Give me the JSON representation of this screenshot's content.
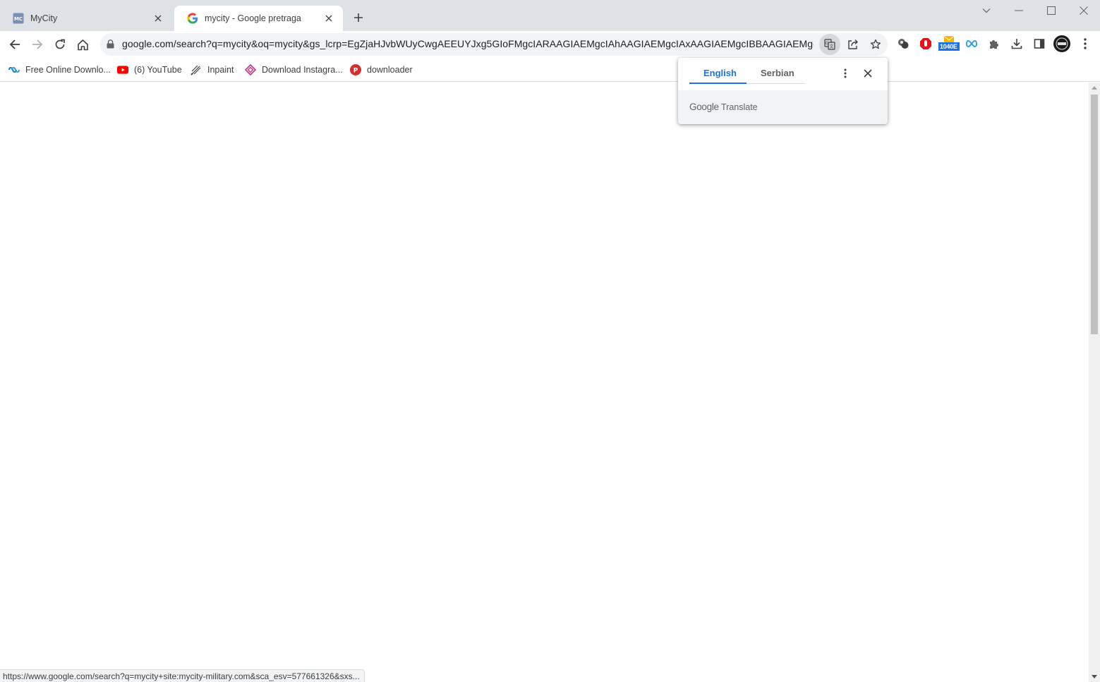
{
  "tabs": [
    {
      "title": "MyCity",
      "favicon": "mycity-favicon",
      "active": false
    },
    {
      "title": "mycity - Google pretraga",
      "favicon": "google-g-icon",
      "active": true
    }
  ],
  "toolbar": {
    "url": "google.com/search?q=mycity&oq=mycity&gs_lcrp=EgZjaHJvbWUyCwgAEEUYJxg5GIoFMgcIARAAGIAEMgcIAhAAGIAEMgcIAxAAGIAEMgcIBBAAGIAEMgcIBR..."
  },
  "extensions": {
    "badge_text": "1040E"
  },
  "bookmarks": [
    {
      "label": "Free Online Downlo...",
      "icon": "link-icon"
    },
    {
      "label": "(6) YouTube",
      "icon": "youtube-icon"
    },
    {
      "label": "Inpaint",
      "icon": "inpaint-icon"
    },
    {
      "label": "Download Instagra...",
      "icon": "instagram-download-icon"
    },
    {
      "label": "downloader",
      "icon": "downloader-icon"
    }
  ],
  "translate": {
    "source_lang": "English",
    "target_lang": "Serbian",
    "brand_google": "Google",
    "brand_translate": "Translate"
  },
  "status": {
    "url": "https://www.google.com/search?q=mycity+site:mycity-military.com&sca_esv=577661326&sxs..."
  },
  "colors": {
    "accent": "#1a73e8",
    "tabstrip": "#dee1e6",
    "youtube": "#ff0000"
  }
}
